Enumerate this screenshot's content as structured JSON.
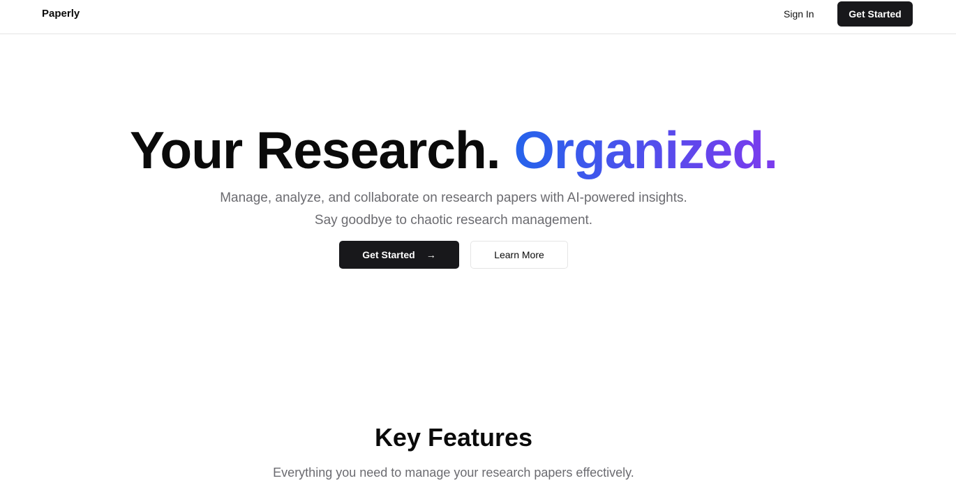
{
  "nav": {
    "logo": "Paperly",
    "sign_in": "Sign In",
    "get_started": "Get Started"
  },
  "hero": {
    "title_main": "Your Research.",
    "title_accent": "Organized.",
    "subtitle": "Manage, analyze, and collaborate on research papers with AI-powered insights. Say goodbye to chaotic research management.",
    "primary_button": "Get Started",
    "arrow": "→",
    "secondary_button": "Learn More",
    "accent_colors": [
      "#2563eb",
      "#7c3aed"
    ]
  },
  "features": {
    "title": "Key Features",
    "subtitle": "Everything you need to manage your research papers effectively."
  }
}
